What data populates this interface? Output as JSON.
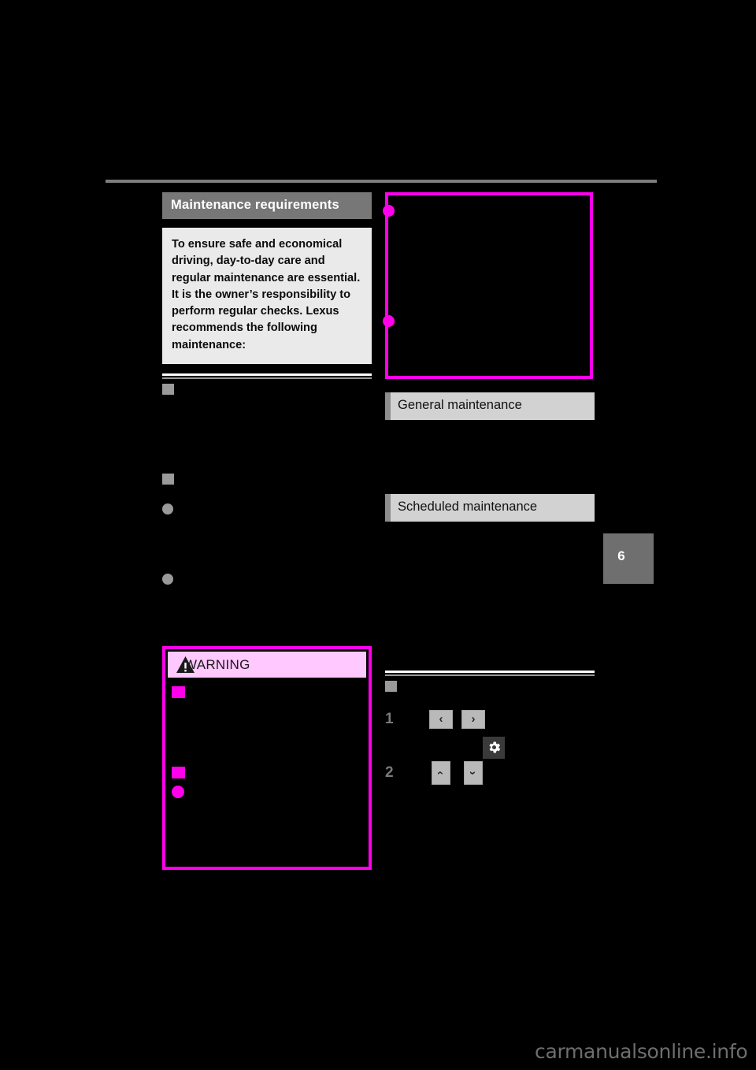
{
  "page": {
    "background_color": "#000000",
    "accent_magenta": "#ff00ea",
    "chapter_number": "6",
    "watermark": "carmanualsonline.info"
  },
  "left_column": {
    "section_title": "Maintenance requirements",
    "intro_paragraph": "To ensure safe and economical driving, day-to-day care and regular maintenance are essential. It is the owner’s responsibility to perform regular checks. Lexus recommends the following maintenance:",
    "subheads": [
      {
        "marker": "square",
        "text": ""
      },
      {
        "marker": "square",
        "text": ""
      }
    ],
    "bullets": [
      {
        "marker": "circle",
        "text": ""
      },
      {
        "marker": "circle",
        "text": ""
      }
    ],
    "warning": {
      "label": "WARNING",
      "icon": "warning-triangle-icon",
      "items": [
        {
          "marker": "square",
          "text": ""
        },
        {
          "marker": "square",
          "text": ""
        },
        {
          "marker": "circle",
          "text": ""
        }
      ]
    }
  },
  "right_column": {
    "callout_box": {
      "bullets": [
        {
          "marker": "dot",
          "text": ""
        },
        {
          "marker": "dot",
          "text": ""
        }
      ]
    },
    "bars": [
      {
        "label": "General maintenance"
      },
      {
        "label": "Scheduled maintenance"
      }
    ],
    "subhead": {
      "marker": "square",
      "text": ""
    },
    "steps": [
      {
        "number": "1",
        "buttons": [
          {
            "icon": "chevron-left-icon",
            "glyph": "‹"
          },
          {
            "icon": "chevron-right-icon",
            "glyph": "›"
          }
        ]
      },
      {
        "number": "2",
        "buttons": [
          {
            "icon": "chevron-up-icon",
            "glyph": "‹"
          },
          {
            "icon": "chevron-down-icon",
            "glyph": "›"
          }
        ]
      }
    ],
    "gear_button": {
      "icon": "gear-icon"
    }
  }
}
